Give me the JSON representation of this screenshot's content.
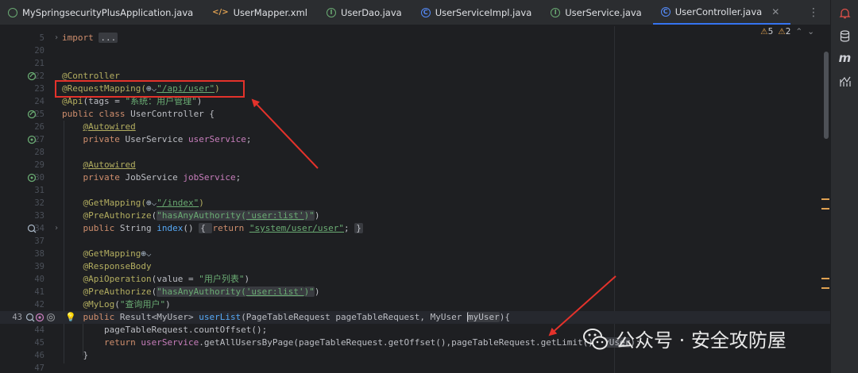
{
  "tabs": [
    {
      "label": "MySpringsecurityPlusApplication.java",
      "icon": "spring-boot-icon",
      "active": false
    },
    {
      "label": "UserMapper.xml",
      "icon": "xml-icon",
      "active": false
    },
    {
      "label": "UserDao.java",
      "icon": "interface-icon",
      "active": false
    },
    {
      "label": "UserServiceImpl.java",
      "icon": "class-icon",
      "active": false
    },
    {
      "label": "UserService.java",
      "icon": "interface-icon",
      "active": false
    },
    {
      "label": "UserController.java",
      "icon": "class-icon",
      "active": true
    }
  ],
  "inspections": {
    "warnings": "5",
    "weak_warnings": "2"
  },
  "right_tools": [
    "notifications-icon",
    "database-icon",
    "maven-icon",
    "profiler-icon"
  ],
  "editor": {
    "line_numbers": [
      "5",
      "20",
      "21",
      "22",
      "23",
      "24",
      "25",
      "26",
      "27",
      "28",
      "29",
      "30",
      "31",
      "32",
      "33",
      "34",
      "37",
      "38",
      "39",
      "40",
      "41",
      "42",
      "43",
      "44",
      "45",
      "46",
      "47"
    ],
    "current_line": "43",
    "code": {
      "l5_import": "import",
      "l5_fold": "...",
      "l22_ann": "@Controller",
      "l23_ann": "@RequestMapping(",
      "l23_globe": "⊕⌵",
      "l23_str": "\"/api/user\"",
      "l23_end": ")",
      "l24_ann": "@Api",
      "l24_a": "(tags = ",
      "l24_str": "\"系统：用户管理\"",
      "l24_end": ")",
      "l25_kw": "public class ",
      "l25_rest": "UserController {",
      "l26_ann": "@Autowired",
      "l27_kw": "private ",
      "l27_type": "UserService ",
      "l27_fld": "userService",
      "l27_end": ";",
      "l29_ann": "@Autowired",
      "l30_kw": "private ",
      "l30_type": "JobService ",
      "l30_fld": "jobService",
      "l30_end": ";",
      "l32_ann": "@GetMapping(",
      "l32_globe": "⊕⌵",
      "l32_str": "\"/index\"",
      "l32_end": ")",
      "l33_ann": "@PreAuthorize",
      "l33_a": "(",
      "l33_s1": "\"hasAnyAuthority(",
      "l33_s2": "'user:list'",
      "l33_s3": ")\"",
      "l33_end": ")",
      "l34_kw": "public ",
      "l34_type": "String ",
      "l34_mth": "index",
      "l34_paren": "() ",
      "l34_open": "{ ",
      "l34_ret": "return ",
      "l34_str": "\"system/user/user\"",
      "l34_semi": "; ",
      "l34_close": "}",
      "l38_ann": "@GetMapping",
      "l38_globe": "⊕⌵",
      "l39_ann": "@ResponseBody",
      "l40_ann": "@ApiOperation",
      "l40_a": "(value = ",
      "l40_str": "\"用户列表\"",
      "l40_end": ")",
      "l41_ann": "@PreAuthorize",
      "l41_a": "(",
      "l41_s1": "\"hasAnyAuthority(",
      "l41_s2": "'user:list'",
      "l41_s3": ")\"",
      "l41_end": ")",
      "l42_ann": "@MyLog",
      "l42_a": "(",
      "l42_str": "\"查询用户\"",
      "l42_end": ")",
      "l43_kw": "public ",
      "l43_type": "Result<MyUser> ",
      "l43_mth": "userList",
      "l43_params": "(PageTableRequest pageTableRequest, MyUser ",
      "l43_hl": "myUser",
      "l43_end": "){",
      "l44_code": "pageTableRequest.countOffset();",
      "l45_ret": "return ",
      "l45_fld": "userService",
      "l45_mid": ".getAllUsersByPage(pageTableRequest.getOffset(),pageTableRequest.getLimit(),",
      "l45_hl": "myUser",
      "l45_end": ");",
      "l46_code": "}"
    }
  },
  "annotation": {
    "box_color": "#e4322b",
    "arrow_color": "#e4322b"
  },
  "watermark": {
    "text": "公众号 · 安全攻防屋",
    "icon": "wechat-icon"
  }
}
